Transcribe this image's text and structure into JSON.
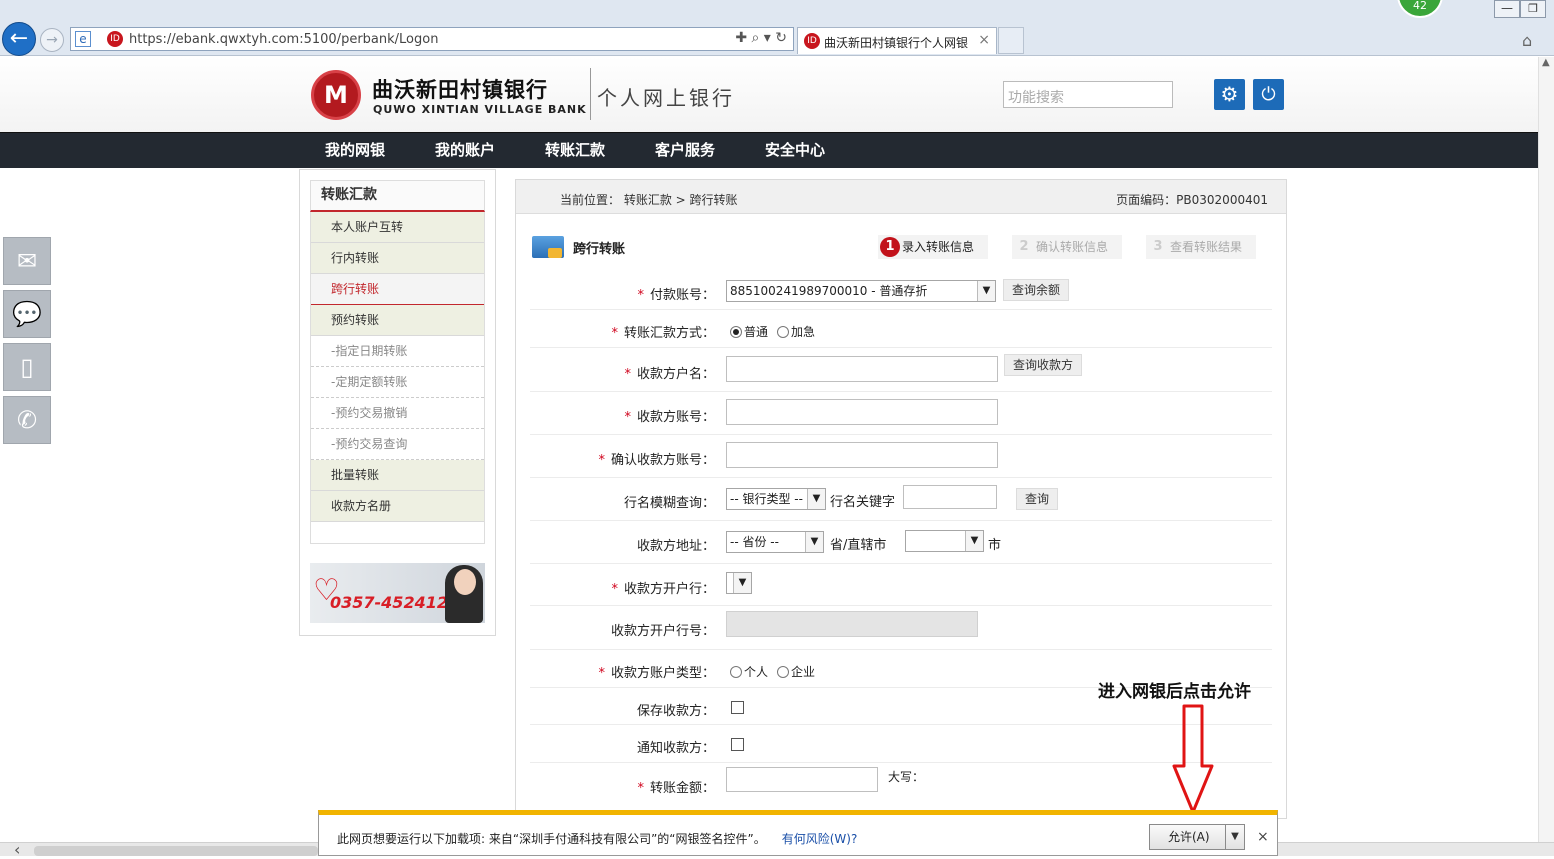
{
  "browser": {
    "url": "https://ebank.qwxtyh.com:5100/perbank/Logon",
    "tab_title": "曲沃新田村镇银行个人网银",
    "badge_count": "42",
    "back_glyph": "←",
    "forward_glyph": "→",
    "favicon_text": "ID",
    "ie_glyph": "e",
    "url_tools": "✚ ⌕ ▾ ↻",
    "tab_close": "×",
    "min_glyph": "—",
    "max_glyph": "❐",
    "home_glyph": "⌂"
  },
  "header": {
    "logo_glyph": "M",
    "bank_name_cn": "曲沃新田村镇银行",
    "bank_name_en": "QUWO XINTIAN VILLAGE BANK",
    "site_title": "个人网上银行",
    "search_placeholder": "功能搜索",
    "settings_glyph": "⚙",
    "power_glyph": "⏻"
  },
  "nav": {
    "items": [
      {
        "label": "我的网银"
      },
      {
        "label": "我的账户"
      },
      {
        "label": "转账汇款"
      },
      {
        "label": "客户服务"
      },
      {
        "label": "安全中心"
      }
    ]
  },
  "side_icons": [
    {
      "icon": "mail-icon",
      "glyph": "✉"
    },
    {
      "icon": "chat-icon",
      "glyph": "💬"
    },
    {
      "icon": "mobile-icon",
      "glyph": "▯"
    },
    {
      "icon": "phone-icon",
      "glyph": "✆"
    }
  ],
  "left_menu": {
    "title": "转账汇款",
    "items": [
      {
        "label": "本人账户互转"
      },
      {
        "label": "行内转账"
      },
      {
        "label": "跨行转账",
        "active": true
      },
      {
        "label": "预约转账"
      },
      {
        "label": "-指定日期转账"
      },
      {
        "label": "-定期定额转账"
      },
      {
        "label": "-预约交易撤销"
      },
      {
        "label": "-预约交易查询"
      },
      {
        "label": "批量转账"
      },
      {
        "label": "收款方名册"
      }
    ],
    "hotline": "0357-4524128",
    "hotline_heart": "♡"
  },
  "content": {
    "breadcrumb": "当前位置： 转账汇款 > 跨行转账",
    "page_code": "页面编码：PB0302000401",
    "section_title": "跨行转账",
    "steps": [
      {
        "num": "1",
        "label": "录入转账信息",
        "active": true
      },
      {
        "num": "2",
        "label": "确认转账信息",
        "active": false
      },
      {
        "num": "3",
        "label": "查看转账结果",
        "active": false
      }
    ],
    "form": {
      "required_mark": "*",
      "payer_account_label": "付款账号：",
      "payer_account_value": "885100241989700010 - 普通存折",
      "query_balance_btn": "查询余额",
      "transfer_mode_label": "转账汇款方式：",
      "mode_normal": "普通",
      "mode_urgent": "加急",
      "payee_name_label": "收款方户名：",
      "query_payee_btn": "查询收款方",
      "payee_account_label": "收款方账号：",
      "confirm_account_label": "确认收款方账号：",
      "bank_fuzzy_label": "行名模糊查询：",
      "bank_type_value": "-- 银行类型 --",
      "bank_keyword_label": "行名关键字",
      "query_btn": "查询",
      "payee_address_label": "收款方地址：",
      "province_value": "-- 省份 --",
      "province_suffix": "省/直辖市",
      "city_suffix": "市",
      "payee_bank_label": "收款方开户行：",
      "payee_bank_no_label": "收款方开户行号：",
      "account_type_label": "收款方账户类型：",
      "type_personal": "个人",
      "type_company": "企业",
      "save_payee_label": "保存收款方：",
      "notify_payee_label": "通知收款方：",
      "amount_label": "转账金额：",
      "amount_upper_label": "大写：",
      "dropdown_arrow": "▼"
    }
  },
  "annotation": {
    "text": "进入网银后点击允许"
  },
  "infobar": {
    "message": "此网页想要运行以下加载项: 来自“深圳手付通科技有限公司”的“网银签名控件”。",
    "risk_link": "有何风险(W)?",
    "allow_btn": "允许(A)",
    "dropdown_glyph": "▼",
    "close_glyph": "×"
  },
  "scrollbar": {
    "left_arrow": "‹",
    "up_arrow": "▲"
  }
}
